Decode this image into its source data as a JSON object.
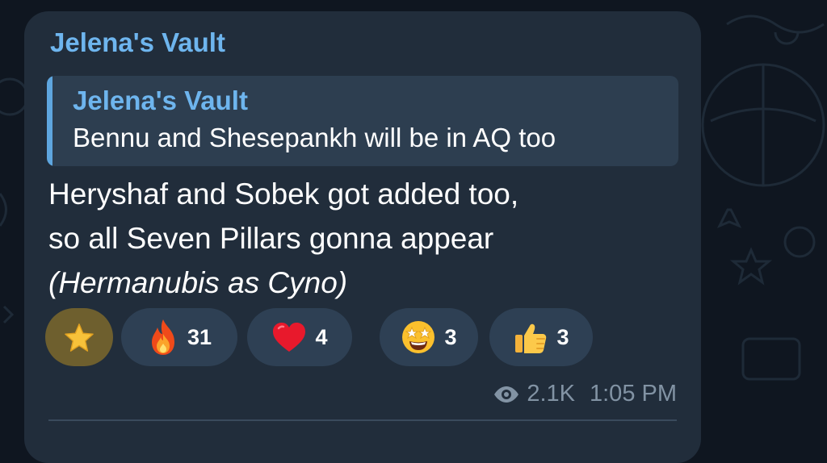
{
  "message": {
    "sender": "Jelena's Vault",
    "reply": {
      "author": "Jelena's Vault",
      "text": "Bennu and Shesepankh will be in AQ too"
    },
    "lines": [
      "Heryshaf and Sobek got added too,",
      "so all Seven Pillars gonna appear",
      "(Hermanubis as Cyno)"
    ],
    "reactions": [
      {
        "emoji": "star-icon",
        "count": ""
      },
      {
        "emoji": "fire-icon",
        "count": "31"
      },
      {
        "emoji": "heart-icon",
        "count": "4"
      },
      {
        "emoji": "star-struck-icon",
        "count": "3"
      },
      {
        "emoji": "thumbs-up-icon",
        "count": "3"
      }
    ],
    "views": "2.1K",
    "time": "1:05 PM"
  },
  "colors": {
    "background": "#0f1620",
    "bubble": "#212d3b",
    "accent": "#6eb5ee",
    "reaction_bg": "#2e4054",
    "reaction_selected_bg": "#6e5f2e",
    "meta_text": "#8293a4"
  }
}
